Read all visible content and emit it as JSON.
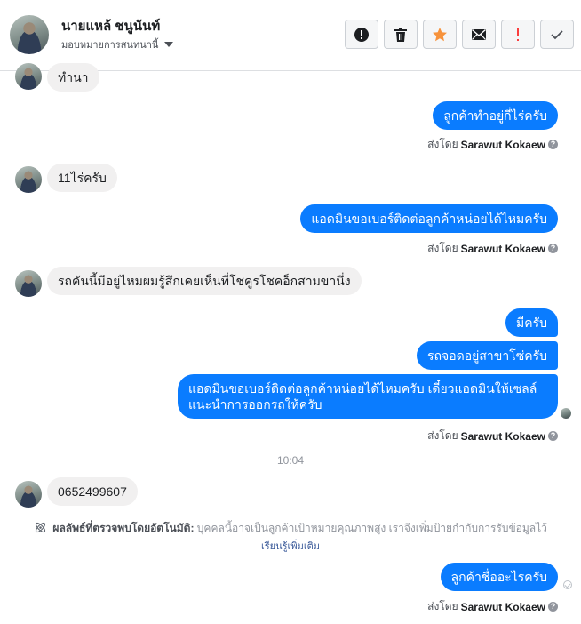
{
  "header": {
    "name": "นายแหล้ ชนูนันท์",
    "assign_label": "มอบหมายการสนทนานี้",
    "actions": [
      {
        "name": "mark-spam-button",
        "icon": "alert-circle-icon"
      },
      {
        "name": "delete-button",
        "icon": "trash-icon"
      },
      {
        "name": "star-button",
        "icon": "star-icon"
      },
      {
        "name": "mark-unread-button",
        "icon": "envelope-icon"
      },
      {
        "name": "follow-up-button",
        "icon": "exclamation-icon"
      },
      {
        "name": "mark-done-button",
        "icon": "check-icon"
      }
    ],
    "colors": {
      "star": "#f7923b",
      "alert": "#fa3e3e"
    }
  },
  "messages": {
    "m0": "ทำนา",
    "m1": "ลูกค้าทำอยู่กี่ไร่ครับ",
    "m2": "11ไร่ครับ",
    "m3": "แอดมินขอเบอร์ติดต่อลูกค้าหน่อยได้ไหมครับ",
    "m4": "รถคันนี้มีอยู่ไหมผมรู้สึกเคยเห็นที่โชคูรโชคอ็กสามขานึ่ง",
    "m5": "มีครับ",
    "m6": "รถจอดอยู่สาขาโซ่ครับ",
    "m7": "แอดมินขอเบอร์ติดต่อลูกค้าหน่อยได้ไหมครับ เดี๋ยวแอดมินให้เซลล์แนะนำการออกรถให้ครับ",
    "m8": "0652499607",
    "m9": "ลูกค้าชื่ออะไรครับ"
  },
  "sent_by": {
    "prefix": "ส่งโดย",
    "name": "Sarawut Kokaew"
  },
  "timestamp": "10:04",
  "notice": {
    "bold": "ผลลัพธ์ที่ตรวจพบโดยอัตโนมัติ:",
    "text": "บุคคลนี้อาจเป็นลูกค้าเป้าหมายคุณภาพสูง เราจึงเพิ่มป้ายกำกับการรับข้อมูลไว้",
    "link": "เรียนรู้เพิ่มเติม"
  },
  "colors": {
    "outgoing_bubble": "#0a7cff",
    "incoming_bubble": "#f1f0f0"
  }
}
